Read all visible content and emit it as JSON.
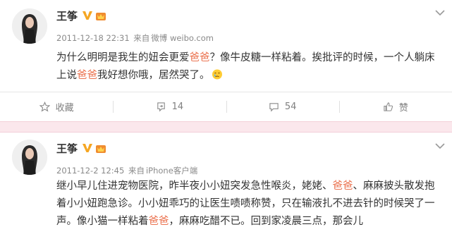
{
  "posts": [
    {
      "username": "王筝",
      "timestamp": "2011-12-18 22:31",
      "source_prefix": "来自",
      "source": "微博 weibo.com",
      "content": [
        {
          "text": "为什么明明是我生的妞会更爱"
        },
        {
          "text": "爸爸",
          "highlight": true
        },
        {
          "text": "？像牛皮糖一样粘着。挨批评的时候，一个人躺床上说"
        },
        {
          "text": "爸爸",
          "highlight": true
        },
        {
          "text": "我好想你哦，居然哭了。"
        }
      ],
      "trailing_emoji": "crying-face-icon",
      "actions": {
        "favorite": "收藏",
        "repost": "14",
        "comment": "54",
        "like": "赞"
      }
    },
    {
      "username": "王筝",
      "timestamp": "2011-12-2 12:45",
      "source_prefix": "来自",
      "source": "iPhone客户端",
      "content": [
        {
          "text": "继小早儿住进宠物医院，昨半夜小小妞突发急性喉炎，姥姥、"
        },
        {
          "text": "爸爸",
          "highlight": true
        },
        {
          "text": "、麻麻披头散发抱着小小妞跑急诊。小小妞乖巧的让医生啧啧称赞，只在输液扎不进去针的时候哭了一声。像小猫一样粘着"
        },
        {
          "text": "爸爸",
          "highlight": true
        },
        {
          "text": "，麻麻吃醋不已。回到家凌晨三点，那会儿"
        }
      ]
    }
  ],
  "colors": {
    "highlight": "#eb7350",
    "separator_band": "#fbe7ec",
    "verified_badge": "#f5a623"
  }
}
